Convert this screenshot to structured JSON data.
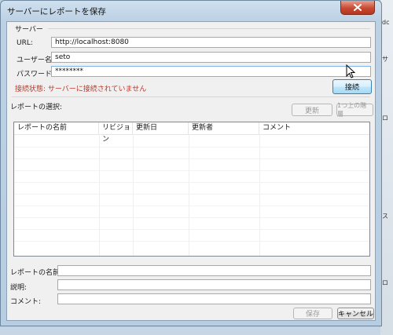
{
  "window": {
    "title": "サーバーにレポートを保存"
  },
  "background_snippets": [
    "dc",
    "サ",
    "ロ",
    "ス",
    "ロ"
  ],
  "server_group": {
    "label": "サーバー",
    "url_label": "URL:",
    "url_value": "http://localhost:8080",
    "user_label": "ユーザー名:",
    "user_value": "seto",
    "password_label": "パスワード:",
    "password_value": "********",
    "status_text": "接続状態: サーバーに接続されていません",
    "connect_button": "接続"
  },
  "report_select": {
    "label": "レポートの選択:",
    "refresh_button": "更新",
    "up_button": "1つ上の階層",
    "columns": [
      "レポートの名前",
      "リビジョン",
      "更新日",
      "更新者",
      "コメント"
    ]
  },
  "fields": {
    "report_name_label": "レポートの名前:",
    "description_label": "説明:",
    "comment_label": "コメント:"
  },
  "buttons": {
    "save": "保存",
    "cancel": "キャンセル"
  },
  "colors": {
    "status_error": "#c0392b",
    "close_button": "#c84a33"
  }
}
